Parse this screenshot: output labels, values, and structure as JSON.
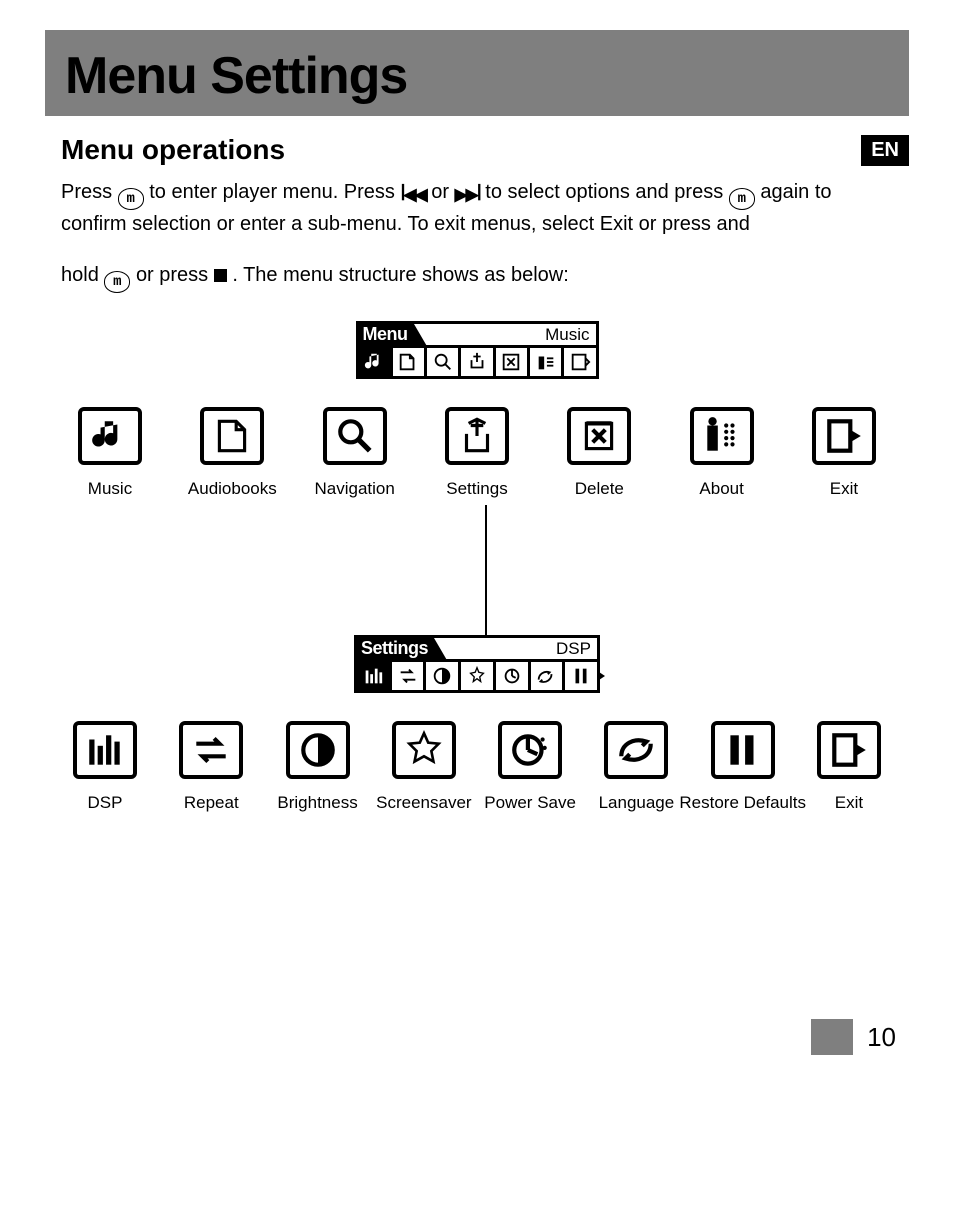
{
  "page_title": "Menu Settings",
  "section_title": "Menu operations",
  "lang_badge": "EN",
  "instructions": {
    "line1a": "Press ",
    "line1b": " to enter player menu. Press ",
    "line1c": " or ",
    "line1d": " to select options and press ",
    "line1e": " again to confirm selection or enter a sub-menu. To exit menus, select Exit or press and",
    "line2a": "hold ",
    "line2b": " or press ",
    "line2c": " . The menu structure shows as below:"
  },
  "lcd_menu": {
    "title": "Menu",
    "selected": "Music",
    "count": 7
  },
  "lcd_settings": {
    "title": "Settings",
    "selected": "DSP",
    "count": 8
  },
  "menu_items": [
    {
      "label": "Music",
      "icon": "music"
    },
    {
      "label": "Audiobooks",
      "icon": "audiobooks"
    },
    {
      "label": "Navigation",
      "icon": "navigation"
    },
    {
      "label": "Settings",
      "icon": "settings"
    },
    {
      "label": "Delete",
      "icon": "delete"
    },
    {
      "label": "About",
      "icon": "about"
    },
    {
      "label": "Exit",
      "icon": "exit"
    }
  ],
  "settings_items": [
    {
      "label": "DSP",
      "icon": "dsp"
    },
    {
      "label": "Repeat",
      "icon": "repeat"
    },
    {
      "label": "Brightness",
      "icon": "brightness"
    },
    {
      "label": "Screensaver",
      "icon": "screensaver"
    },
    {
      "label": "Power Save",
      "icon": "powersave"
    },
    {
      "label": "Language",
      "icon": "language"
    },
    {
      "label": "Restore Defaults",
      "icon": "restore"
    },
    {
      "label": "Exit",
      "icon": "exit"
    }
  ],
  "page_number": "10"
}
